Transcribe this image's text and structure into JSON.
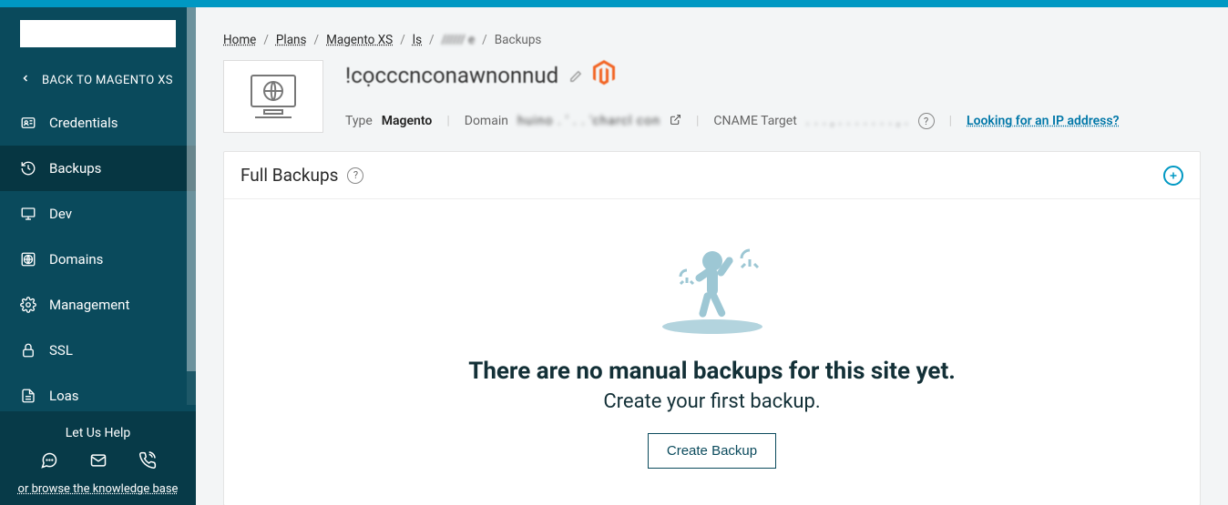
{
  "sidebar": {
    "back_label": "BACK TO MAGENTO XS",
    "items": [
      {
        "label": "Credentials",
        "icon": "id-card"
      },
      {
        "label": "Backups",
        "icon": "history",
        "active": true
      },
      {
        "label": "Dev",
        "icon": "monitor"
      },
      {
        "label": "Domains",
        "icon": "globe-box"
      },
      {
        "label": "Management",
        "icon": "gear"
      },
      {
        "label": "SSL",
        "icon": "lock"
      },
      {
        "label": "Loas",
        "icon": "document"
      }
    ],
    "help_title": "Let Us Help",
    "kb_link": "or browse the knowledge base"
  },
  "breadcrumb": {
    "items": [
      {
        "label": "Home",
        "link": true
      },
      {
        "label": "Plans",
        "link": true
      },
      {
        "label": "Magento XS",
        "link": true
      },
      {
        "label": "ls",
        "link": true
      },
      {
        "label": "////// e",
        "link": false
      },
      {
        "label": "Backups",
        "current": true
      }
    ]
  },
  "site": {
    "title": "!cọcccnconawnonnud",
    "type_label": "Type",
    "type_value": "Magento",
    "domain_label": "Domain",
    "domain_value": "huino . ' . . 'charcl con",
    "cname_label": "CNAME Target",
    "cname_value": ". . . , .  . . . .  . . , .",
    "ip_link": "Looking for an IP address?"
  },
  "card": {
    "title": "Full Backups",
    "empty_title": "There are no manual backups for this site yet.",
    "empty_sub": "Create your first backup.",
    "create_label": "Create Backup"
  }
}
